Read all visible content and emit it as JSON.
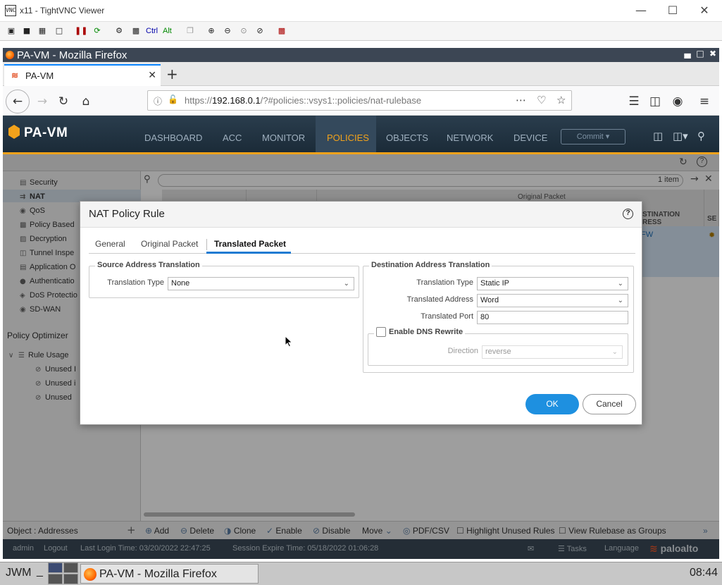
{
  "vnc": {
    "title": "x11 - TightVNC Viewer",
    "icon_label": "VNC",
    "toolbar_text": [
      "Ctrl",
      "Alt"
    ]
  },
  "firefox": {
    "window_title": "PA-VM - Mozilla Firefox",
    "tab_title": "PA-VM",
    "url_host": "192.168.0.1",
    "url_prefix": "https://",
    "url_path": "/?#policies::vsys1::policies/nat-rulebase"
  },
  "app": {
    "logo": "PA-VM",
    "nav": [
      "DASHBOARD",
      "ACC",
      "MONITOR",
      "POLICIES",
      "OBJECTS",
      "NETWORK",
      "DEVICE"
    ],
    "commit_label": "Commit",
    "sidebar": [
      {
        "label": "Security"
      },
      {
        "label": "NAT"
      },
      {
        "label": "QoS"
      },
      {
        "label": "Policy Based"
      },
      {
        "label": "Decryption"
      },
      {
        "label": "Tunnel Inspe"
      },
      {
        "label": "Application O"
      },
      {
        "label": "Authenticatio"
      },
      {
        "label": "DoS Protectio"
      },
      {
        "label": "SD-WAN"
      }
    ],
    "policy_optimizer": "Policy Optimizer",
    "rule_usage": "Rule Usage",
    "unused_items": [
      "Unused I",
      "Unused i",
      "Unused"
    ],
    "object_addresses": "Object : Addresses",
    "item_count": "1 item",
    "col_original_packet": "Original Packet",
    "col_destination": "STINATION\nRESS",
    "col_se": "SE",
    "row_value": "FW",
    "bottom_toolbar": [
      "Add",
      "Delete",
      "Clone",
      "Enable",
      "Disable",
      "Move",
      "PDF/CSV",
      "Highlight Unused Rules",
      "View Rulebase as Groups"
    ],
    "status": {
      "user": "admin",
      "logout": "Logout",
      "last_login": "Last Login Time: 03/20/2022 22:47:25",
      "session_expire": "Session Expire Time: 05/18/2022 01:06:28",
      "tasks": "Tasks",
      "language": "Language",
      "brand": "paloalto"
    }
  },
  "modal": {
    "title": "NAT Policy Rule",
    "tabs": [
      {
        "label": "General",
        "active": false
      },
      {
        "label": "Original Packet",
        "active": false
      },
      {
        "label": "Translated Packet",
        "active": true
      }
    ],
    "source": {
      "legend": "Source Address Translation",
      "translation_type_label": "Translation Type",
      "translation_type_value": "None"
    },
    "destination": {
      "legend": "Destination Address Translation",
      "translation_type_label": "Translation Type",
      "translation_type_value": "Static IP",
      "translated_address_label": "Translated Address",
      "translated_address_value": "Word",
      "translated_port_label": "Translated Port",
      "translated_port_value": "80",
      "dns_rewrite_label": "Enable DNS Rewrite",
      "dns_rewrite_checked": false,
      "direction_label": "Direction",
      "direction_value": "reverse"
    },
    "ok_label": "OK",
    "cancel_label": "Cancel"
  },
  "taskbar": {
    "wm_label": "JWM",
    "min_label": "_",
    "task_label": "PA-VM - Mozilla Firefox",
    "clock": "08:44"
  },
  "colors": {
    "accent": "#f2a21b",
    "primary_button": "#1e90e0",
    "tab_underline": "#1f7bd2"
  }
}
